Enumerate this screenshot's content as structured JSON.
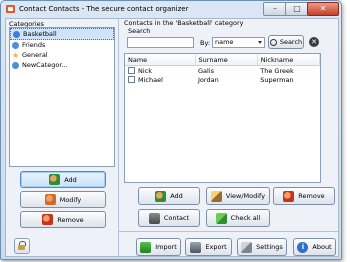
{
  "window": {
    "title": "Contact Contacts - The secure contact organizer",
    "min_glyph": "–",
    "max_glyph": "□",
    "close_glyph": "✕"
  },
  "categories": {
    "label": "Categories",
    "items": [
      {
        "label": "Basketball",
        "icon": "globe-icon",
        "color": "#3b7fd0",
        "selected": true
      },
      {
        "label": "Friends",
        "icon": "globe-icon",
        "color": "#4a8fd8",
        "selected": false
      },
      {
        "label": "General",
        "icon": "star-icon",
        "color": "#f0b820",
        "selected": false
      },
      {
        "label": "NewCategor...",
        "icon": "globe-icon",
        "color": "#4a8fd8",
        "selected": false
      }
    ],
    "add_label": "Add",
    "modify_label": "Modify",
    "remove_label": "Remove"
  },
  "contacts": {
    "heading": "Contacts in the 'Basketball' category",
    "search_label": "Search",
    "search_value": "",
    "by_label": "By:",
    "by_value": "name",
    "search_button": "Search",
    "clear_glyph": "✕",
    "columns": [
      "Name",
      "Surname",
      "Nickname"
    ],
    "rows": [
      {
        "name": "Nick",
        "surname": "Galis",
        "nickname": "The Greek"
      },
      {
        "name": "Michael",
        "surname": "Jordan",
        "nickname": "Superman"
      }
    ],
    "add_label": "Add",
    "view_modify_label": "View/Modify",
    "remove_label": "Remove",
    "contact_label": "Contact",
    "check_all_label": "Check all"
  },
  "footer": {
    "import_label": "Import",
    "export_label": "Export",
    "settings_label": "Settings",
    "about_label": "About"
  },
  "colors": {
    "accent": "#4a8ed8",
    "add_icon": "#2f8f2f",
    "remove_icon": "#c8321e",
    "modify_icon": "#d46a2a"
  }
}
